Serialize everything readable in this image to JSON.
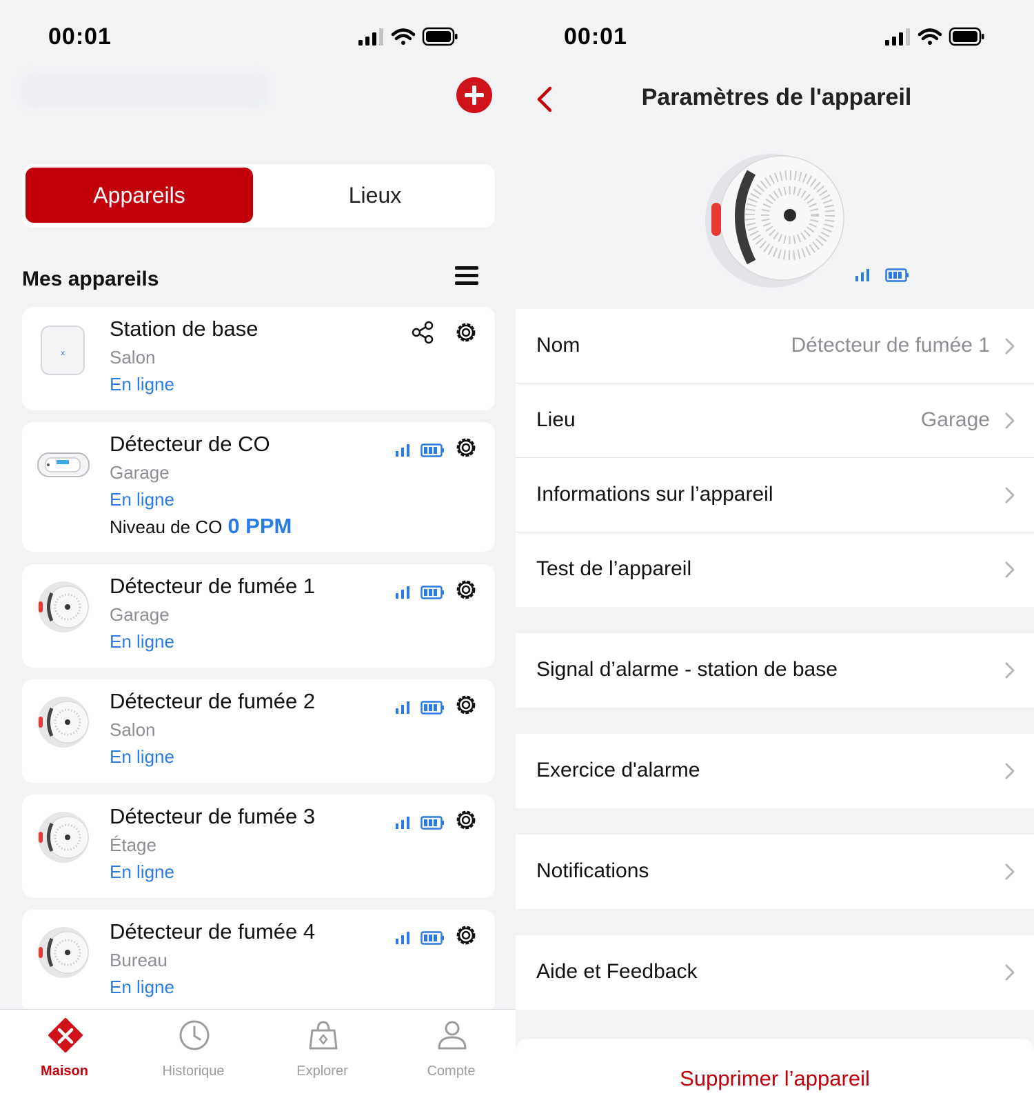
{
  "left": {
    "status_time": "00:01",
    "segment": {
      "active": "Appareils",
      "inactive": "Lieux"
    },
    "section_title": "Mes appareils",
    "devices": [
      {
        "name": "Station de base",
        "room": "Salon",
        "status": "En ligne"
      },
      {
        "name": "Détecteur de CO",
        "room": "Garage",
        "status": "En ligne",
        "co_label": "Niveau de CO",
        "co_value": "0 PPM"
      },
      {
        "name": "Détecteur de fumée 1",
        "room": "Garage",
        "status": "En ligne"
      },
      {
        "name": "Détecteur de fumée 2",
        "room": "Salon",
        "status": "En ligne"
      },
      {
        "name": "Détecteur de fumée 3",
        "room": "Étage",
        "status": "En ligne"
      },
      {
        "name": "Détecteur de fumée 4",
        "room": "Bureau",
        "status": "En ligne"
      }
    ],
    "tabs": [
      {
        "label": "Maison",
        "icon": "x-logo-icon"
      },
      {
        "label": "Historique",
        "icon": "clock-icon"
      },
      {
        "label": "Explorer",
        "icon": "bag-icon"
      },
      {
        "label": "Compte",
        "icon": "person-icon"
      }
    ]
  },
  "right": {
    "status_time": "00:01",
    "title": "Paramètres de l'appareil",
    "rows": [
      {
        "label": "Nom",
        "value": "Détecteur de fumée 1"
      },
      {
        "label": "Lieu",
        "value": "Garage"
      },
      {
        "label": "Informations sur l’appareil"
      },
      {
        "label": "Test de l’appareil"
      },
      {
        "label": "Signal d’alarme - station de base"
      },
      {
        "label": "Exercice d'alarme"
      },
      {
        "label": "Notifications"
      },
      {
        "label": "Aide et Feedback"
      }
    ],
    "delete_label": "Supprimer l’appareil"
  },
  "colors": {
    "brand_red": "#c2000b",
    "online_blue": "#2a7be4",
    "muted_gray": "#8b8e93",
    "background": "#f2f3f5"
  }
}
